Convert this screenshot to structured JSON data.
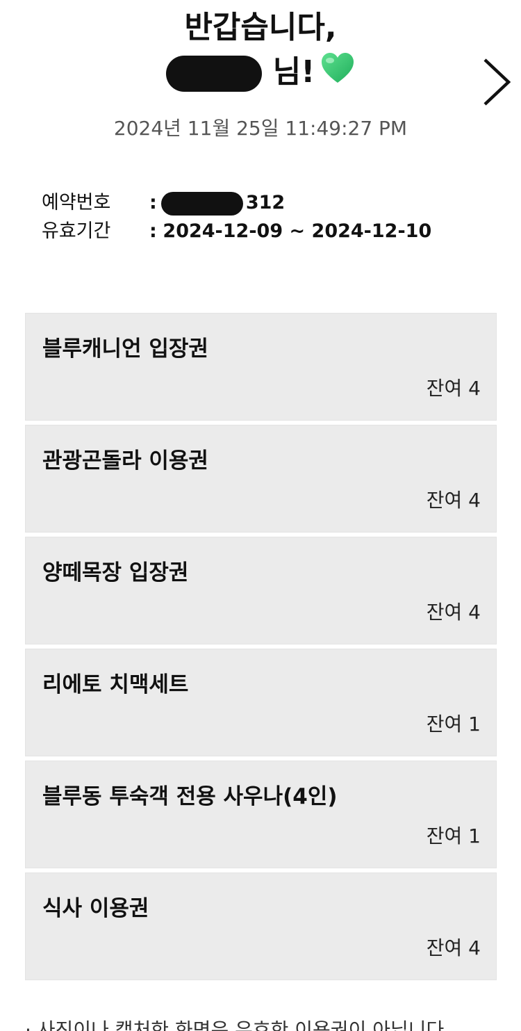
{
  "header": {
    "greeting_line1": "반갑습니다,",
    "greeting_suffix": "님!",
    "timestamp": "2024년 11월 25일 11:49:27 PM"
  },
  "reservation": {
    "number_label": "예약번호",
    "number_value_visible": "312",
    "validity_label": "유효기간",
    "validity_value": "2024-12-09 ~ 2024-12-10",
    "separator": ":"
  },
  "tickets": [
    {
      "name": "블루캐니언 입장권",
      "remaining": "잔여 4"
    },
    {
      "name": "관광곤돌라 이용권",
      "remaining": "잔여 4"
    },
    {
      "name": "양떼목장 입장권",
      "remaining": "잔여 4"
    },
    {
      "name": "리에토 치맥세트",
      "remaining": "잔여 1"
    },
    {
      "name": "블루동 투숙객 전용 사우나(4인)",
      "remaining": "잔여 1"
    },
    {
      "name": "식사 이용권",
      "remaining": "잔여 4"
    }
  ],
  "notice": {
    "text": "· 사진이나 캡처한 화면은 유효한 이용권이 아닙니다"
  },
  "colors": {
    "heart": "#2ecc71",
    "card_bg": "#ebebeb",
    "timestamp": "#555555"
  },
  "icons": {
    "next": "chevron-right-icon",
    "heart": "green-heart-icon"
  }
}
